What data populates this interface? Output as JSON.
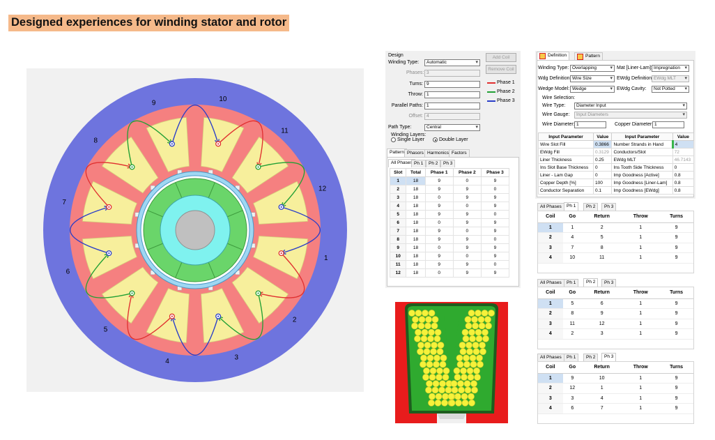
{
  "headline": "Designed experiences for winding stator and rotor",
  "colors": {
    "phase1": "#e03030",
    "phase2": "#22a035",
    "phase3": "#2a3ec8",
    "housing": "#6e74de",
    "stator": "#f58080",
    "slotFill": "#f7ef9c",
    "rotorGreen": "#6ad56a",
    "shaftCyan": "#7ff2ef"
  },
  "motor": {
    "slots": 12,
    "coil_labels": [
      "1",
      "2",
      "3",
      "4",
      "5",
      "6",
      "7",
      "8",
      "9",
      "10",
      "11",
      "12"
    ]
  },
  "design_panel": {
    "title": "Design",
    "winding_type_label": "Winding Type:",
    "winding_type_value": "Automatic",
    "phases_label": "Phases:",
    "phases_value": "3",
    "turns_label": "Turns:",
    "turns_value": "9",
    "throw_label": "Throw:",
    "throw_value": "1",
    "parallel_paths_label": "Parallel Paths:",
    "parallel_paths_value": "1",
    "offset_label": "Offset:",
    "offset_value": "4",
    "path_type_label": "Path Type:",
    "path_type_value": "Central",
    "winding_layers_label": "Winding Layers:",
    "single_layer": "Single Layer",
    "double_layer": "Double Layer",
    "add_coil": "Add Coil",
    "remove_coil": "Remove Coil",
    "legend": [
      "Phase 1",
      "Phase 2",
      "Phase 3"
    ],
    "tabs": [
      "Pattern",
      "Phasors",
      "Harmonics",
      "Factors"
    ],
    "subtabs": [
      "All Phases",
      "Ph 1",
      "Ph 2",
      "Ph 3"
    ],
    "table_headers": [
      "Slot",
      "Total",
      "Phase 1",
      "Phase 2",
      "Phase 3"
    ],
    "table_rows": [
      [
        "1",
        "18",
        "9",
        "0",
        "9"
      ],
      [
        "2",
        "18",
        "9",
        "9",
        "0"
      ],
      [
        "3",
        "18",
        "0",
        "9",
        "9"
      ],
      [
        "4",
        "18",
        "9",
        "0",
        "9"
      ],
      [
        "5",
        "18",
        "9",
        "9",
        "0"
      ],
      [
        "6",
        "18",
        "0",
        "9",
        "9"
      ],
      [
        "7",
        "18",
        "9",
        "0",
        "9"
      ],
      [
        "8",
        "18",
        "9",
        "9",
        "0"
      ],
      [
        "9",
        "18",
        "0",
        "9",
        "9"
      ],
      [
        "10",
        "18",
        "9",
        "0",
        "9"
      ],
      [
        "11",
        "18",
        "9",
        "9",
        "0"
      ],
      [
        "12",
        "18",
        "0",
        "9",
        "9"
      ]
    ]
  },
  "definition_panel": {
    "tabs": [
      "Definition",
      "Pattern"
    ],
    "winding_type_label": "Winding Type:",
    "winding_type_value": "Overlapping",
    "mat_label": "Mat [Liner-Lam]:",
    "mat_value": "Impregnation",
    "wdg_def_label": "Wdg Definition:",
    "wdg_def_value": "Wire Size",
    "ewdg_def_label": "EWdg Definition:",
    "ewdg_def_value": "EWdg MLT",
    "wedge_model_label": "Wedge Model:",
    "wedge_model_value": "Wedge",
    "ewdg_cavity_label": "EWdg Cavity:",
    "ewdg_cavity_value": "Not Potted",
    "wire_selection_label": "Wire Selection:",
    "wire_type_label": "Wire Type:",
    "wire_type_value": "Diameter Input",
    "wire_gauge_label": "Wire Gauge:",
    "wire_gauge_value": "Input Diameters",
    "wire_diameter_label": "Wire Diameter:",
    "wire_diameter_value": "1",
    "copper_diameter_label": "Copper Diameter:",
    "copper_diameter_value": "1",
    "param_headers": [
      "Input Parameter",
      "Value",
      "Input Parameter",
      "Value"
    ],
    "params": [
      [
        "Wire Slot Fill",
        "0.3866",
        "Number Strands in Hand",
        "4"
      ],
      [
        "EWdg Fill",
        "0.3129",
        "Conductors/Slot",
        "72"
      ],
      [
        "Liner Thickness",
        "0.25",
        "EWdg MLT",
        "46.7143"
      ],
      [
        "Ins Slot Base Thickness",
        "0",
        "Ins Tooth Side Thickness",
        "0"
      ],
      [
        "Liner - Lam Gap",
        "0",
        "Imp Goodness [Active]",
        "0.8"
      ],
      [
        "Copper Depth [%]",
        "100",
        "Imp Goodness [Liner-Lam]",
        "0.8"
      ],
      [
        "Conductor Separation",
        "0.1",
        "Imp Goodness [EWdg]",
        "0.8"
      ]
    ]
  },
  "coil_tables": [
    {
      "tabs": [
        "All Phases",
        "Ph 1",
        "Ph 2",
        "Ph 3"
      ],
      "active": 1,
      "headers": [
        "Coil",
        "Go",
        "Return",
        "Throw",
        "Turns"
      ],
      "rows": [
        [
          "1",
          "1",
          "2",
          "1",
          "9"
        ],
        [
          "2",
          "4",
          "5",
          "1",
          "9"
        ],
        [
          "3",
          "7",
          "8",
          "1",
          "9"
        ],
        [
          "4",
          "10",
          "11",
          "1",
          "9"
        ]
      ]
    },
    {
      "tabs": [
        "All Phases",
        "Ph 1",
        "Ph 2",
        "Ph 3"
      ],
      "active": 2,
      "headers": [
        "Coil",
        "Go",
        "Return",
        "Throw",
        "Turns"
      ],
      "rows": [
        [
          "1",
          "5",
          "6",
          "1",
          "9"
        ],
        [
          "2",
          "8",
          "9",
          "1",
          "9"
        ],
        [
          "3",
          "11",
          "12",
          "1",
          "9"
        ],
        [
          "4",
          "2",
          "3",
          "1",
          "9"
        ]
      ]
    },
    {
      "tabs": [
        "All Phases",
        "Ph 1",
        "Ph 2",
        "Ph 3"
      ],
      "active": 3,
      "headers": [
        "Coil",
        "Go",
        "Return",
        "Throw",
        "Turns"
      ],
      "rows": [
        [
          "1",
          "9",
          "10",
          "1",
          "9"
        ],
        [
          "2",
          "12",
          "1",
          "1",
          "9"
        ],
        [
          "3",
          "3",
          "4",
          "1",
          "9"
        ],
        [
          "4",
          "6",
          "7",
          "1",
          "9"
        ]
      ]
    }
  ]
}
